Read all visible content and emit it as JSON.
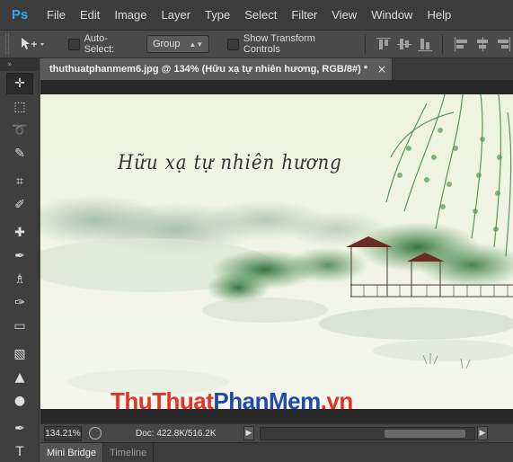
{
  "app": {
    "logo": "Ps"
  },
  "menu": [
    "File",
    "Edit",
    "Image",
    "Layer",
    "Type",
    "Select",
    "Filter",
    "View",
    "Window",
    "Help"
  ],
  "options_bar": {
    "auto_select_label": "Auto-Select:",
    "auto_select_value": "Group",
    "show_transform_label": "Show Transform Controls"
  },
  "document": {
    "tab_title": "thuthuatphanmem6.jpg @ 134% (Hữu xạ tự nhiên hương, RGB/8#) *",
    "close_glyph": "×",
    "canvas_text": "Hữu xạ tự nhiên hương",
    "watermark_part1": "ThuThuat",
    "watermark_part2": "PhanMem",
    "watermark_part3": ".vn"
  },
  "status": {
    "zoom": "134.21%",
    "doc_info": "Doc: 422.8K/516.2K"
  },
  "bottom_tabs": [
    "Mini Bridge",
    "Timeline"
  ],
  "tools": [
    {
      "name": "move-tool",
      "glyph": "✛"
    },
    {
      "name": "marquee-tool",
      "glyph": "⬚"
    },
    {
      "name": "lasso-tool",
      "glyph": "➰"
    },
    {
      "name": "quick-select-tool",
      "glyph": "✎"
    },
    {
      "name": "crop-tool",
      "glyph": "⌗"
    },
    {
      "name": "eyedropper-tool",
      "glyph": "✐"
    },
    {
      "name": "healing-brush-tool",
      "glyph": "✚"
    },
    {
      "name": "brush-tool",
      "glyph": "✒"
    },
    {
      "name": "clone-stamp-tool",
      "glyph": "♗"
    },
    {
      "name": "history-brush-tool",
      "glyph": "✑"
    },
    {
      "name": "eraser-tool",
      "glyph": "▭"
    },
    {
      "name": "gradient-tool",
      "glyph": "▧"
    },
    {
      "name": "blur-tool",
      "glyph": "▲"
    },
    {
      "name": "dodge-tool",
      "glyph": "●"
    },
    {
      "name": "pen-tool",
      "glyph": "✒"
    },
    {
      "name": "type-tool",
      "glyph": "T"
    }
  ],
  "colors": {
    "accent": "#31a8ff",
    "watermark_red": "#e63226",
    "watermark_blue": "#1e4aa8"
  }
}
